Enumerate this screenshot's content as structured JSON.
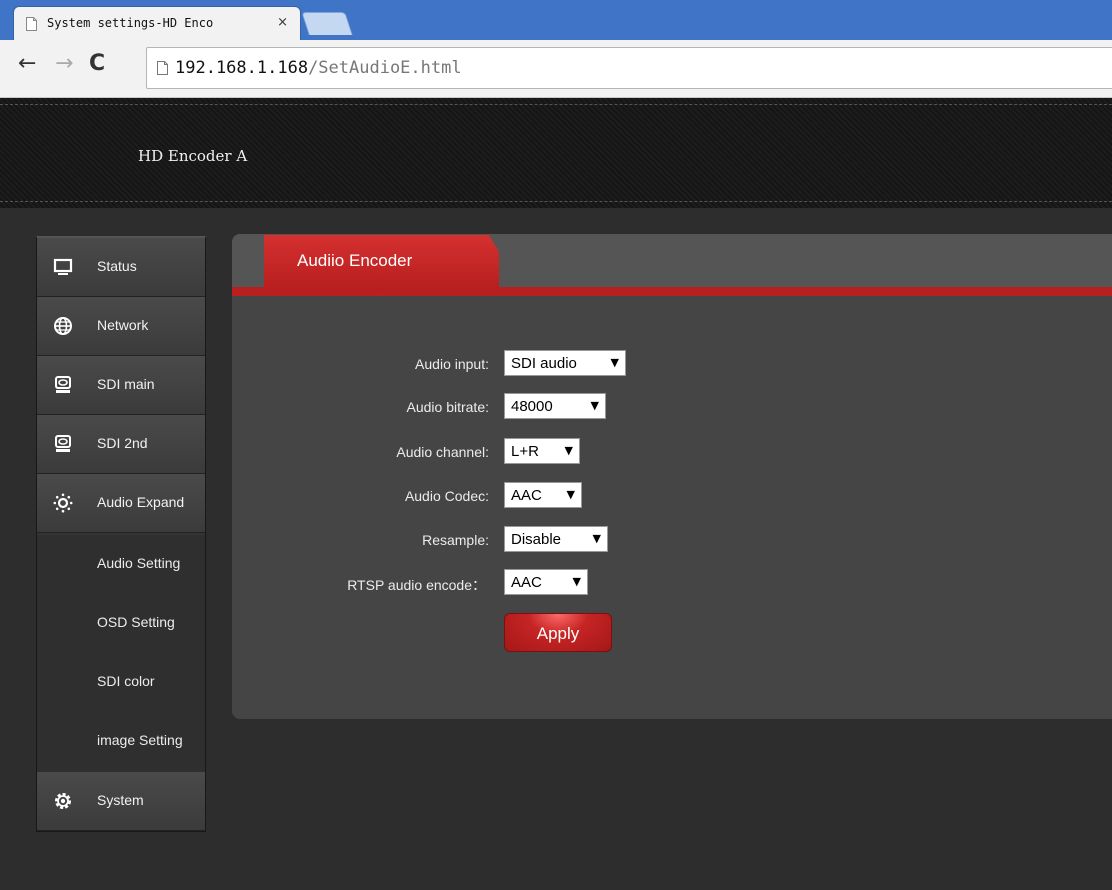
{
  "browser": {
    "tab_title": "System settings-HD Enco",
    "tab_close": "×",
    "nav": {
      "back": "←",
      "forward": "→",
      "reload": "C"
    },
    "url_host": "192.168.1.168",
    "url_path": "/SetAudioE.html"
  },
  "header": {
    "brand": "HD Encoder A"
  },
  "sidebar": {
    "items": [
      {
        "label": "Status",
        "icon": "monitor-icon"
      },
      {
        "label": "Network",
        "icon": "globe-icon"
      },
      {
        "label": "SDI main",
        "icon": "disk-drive-icon"
      },
      {
        "label": "SDI 2nd",
        "icon": "disk-drive-icon"
      },
      {
        "label": "Audio Expand",
        "icon": "sun-gear-icon"
      }
    ],
    "subitems": [
      {
        "label": "Audio Setting"
      },
      {
        "label": "OSD Setting"
      },
      {
        "label": "SDI color"
      },
      {
        "label": "image Setting"
      }
    ],
    "system": {
      "label": "System",
      "icon": "gear-icon"
    }
  },
  "panel": {
    "tab_label": "Audiio Encoder",
    "fields": [
      {
        "label": "Audio input:",
        "value": "SDI audio"
      },
      {
        "label": "Audio bitrate:",
        "value": "48000"
      },
      {
        "label": "Audio channel:",
        "value": "L+R"
      },
      {
        "label": "Audio Codec:",
        "value": "AAC"
      },
      {
        "label": "Resample:",
        "value": "Disable"
      },
      {
        "label": "RTSP audio encode：",
        "value": "AAC"
      }
    ],
    "apply_label": "Apply"
  },
  "colors": {
    "accent_red": "#b81f1f",
    "browser_blue": "#3f74c6",
    "page_bg": "#2d2d2d"
  }
}
